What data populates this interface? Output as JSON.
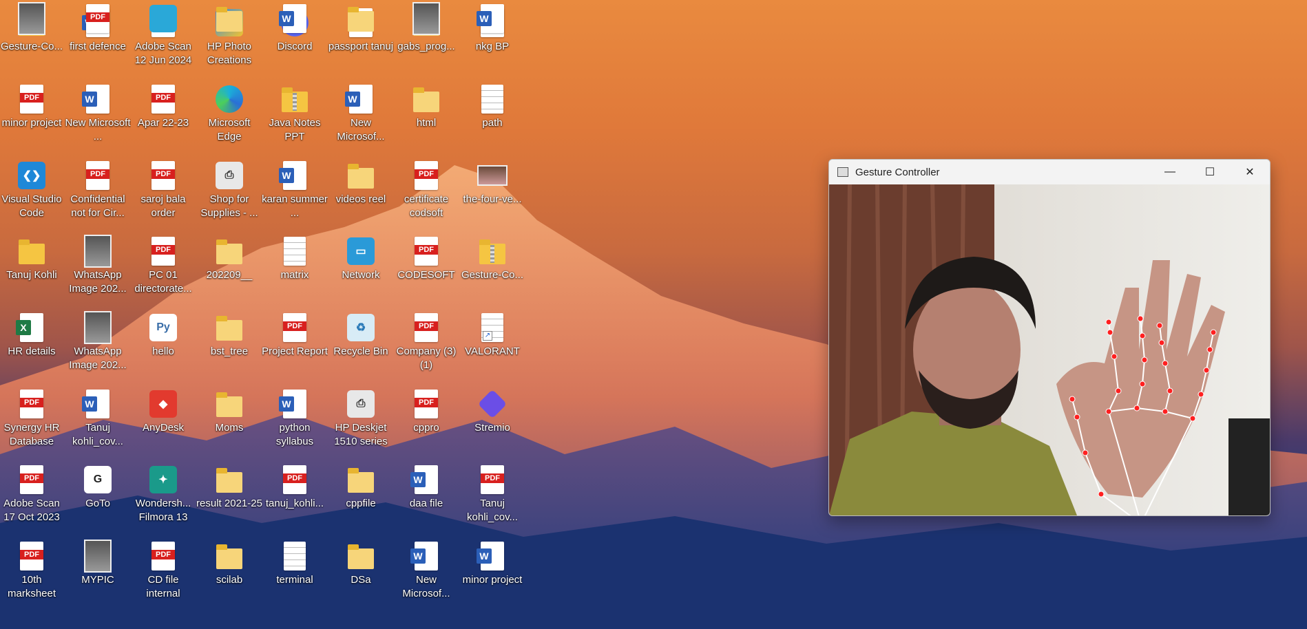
{
  "desktop": {
    "icons": [
      {
        "label": "Gesture-Co...",
        "type": "folder"
      },
      {
        "label": "first defence",
        "type": "doc"
      },
      {
        "label": "Adobe Scan 12 Jun 2024",
        "type": "pdf"
      },
      {
        "label": "HP Photo Creations",
        "type": "app-photo"
      },
      {
        "label": "Discord",
        "type": "app-discord"
      },
      {
        "label": "passport tanuj",
        "type": "pdf"
      },
      {
        "label": "gabs_prog...",
        "type": "folder-light"
      },
      {
        "label": "nkg BP",
        "type": "pdf"
      },
      {
        "label": "minor project",
        "type": "pdf"
      },
      {
        "label": "New Microsoft ...",
        "type": "doc"
      },
      {
        "label": "Apar 22-23",
        "type": "pdf"
      },
      {
        "label": "Microsoft Edge",
        "type": "app-edge"
      },
      {
        "label": "Java Notes PPT",
        "type": "folder-zip"
      },
      {
        "label": "New Microsof...",
        "type": "doc"
      },
      {
        "label": "html",
        "type": "folder-light"
      },
      {
        "label": "path",
        "type": "txt"
      },
      {
        "label": "Visual Studio Code",
        "type": "app-vscode"
      },
      {
        "label": "Confidential not for Cir...",
        "type": "pdf"
      },
      {
        "label": "saroj bala order",
        "type": "pdf"
      },
      {
        "label": "Shop for Supplies - ...",
        "type": "app-printer"
      },
      {
        "label": "karan summer ...",
        "type": "doc"
      },
      {
        "label": "videos reel",
        "type": "folder-light"
      },
      {
        "label": "certificate codsoft",
        "type": "pdf"
      },
      {
        "label": "the-four-ve...",
        "type": "image"
      },
      {
        "label": "Tanuj Kohli",
        "type": "folder"
      },
      {
        "label": "WhatsApp Image 202...",
        "type": "photo"
      },
      {
        "label": "PC 01 directorate...",
        "type": "pdf"
      },
      {
        "label": "202209__",
        "type": "folder-light"
      },
      {
        "label": "matrix",
        "type": "txt"
      },
      {
        "label": "Network",
        "type": "app-network"
      },
      {
        "label": "CODESOFT",
        "type": "pdf"
      },
      {
        "label": "Gesture-Co...",
        "type": "folder-zip"
      },
      {
        "label": "HR details",
        "type": "xls"
      },
      {
        "label": "WhatsApp Image 202...",
        "type": "photo"
      },
      {
        "label": "hello",
        "type": "app-python"
      },
      {
        "label": "bst_tree",
        "type": "folder-light"
      },
      {
        "label": "Project Report",
        "type": "pdf"
      },
      {
        "label": "Recycle Bin",
        "type": "app-recycle"
      },
      {
        "label": "Company (3) (1)",
        "type": "pdf"
      },
      {
        "label": "VALORANT",
        "type": "shortcut-file"
      },
      {
        "label": "Synergy HR Database",
        "type": "pdf"
      },
      {
        "label": "Tanuj kohli_cov...",
        "type": "doc"
      },
      {
        "label": "AnyDesk",
        "type": "app-anydesk"
      },
      {
        "label": "Moms",
        "type": "folder-light"
      },
      {
        "label": "python syllabus",
        "type": "doc"
      },
      {
        "label": "HP Deskjet 1510 series",
        "type": "app-printer"
      },
      {
        "label": "cppro",
        "type": "pdf"
      },
      {
        "label": "Stremio",
        "type": "app-stremio"
      },
      {
        "label": "Adobe Scan 17 Oct 2023",
        "type": "pdf"
      },
      {
        "label": "GoTo",
        "type": "app-goto"
      },
      {
        "label": "Wondersh... Filmora 13",
        "type": "app-filmora"
      },
      {
        "label": "result 2021-25",
        "type": "folder-light"
      },
      {
        "label": "tanuj_kohli...",
        "type": "pdf"
      },
      {
        "label": "cppfile",
        "type": "folder-light"
      },
      {
        "label": "daa file",
        "type": "doc"
      },
      {
        "label": "Tanuj kohli_cov...",
        "type": "pdf"
      },
      {
        "label": "10th marksheet",
        "type": "pdf"
      },
      {
        "label": "MYPIC",
        "type": "photo"
      },
      {
        "label": "CD file internal",
        "type": "pdf"
      },
      {
        "label": "scilab",
        "type": "folder-light"
      },
      {
        "label": "terminal",
        "type": "txt"
      },
      {
        "label": "DSa",
        "type": "folder-light"
      },
      {
        "label": "New Microsof...",
        "type": "doc"
      },
      {
        "label": "minor project",
        "type": "doc"
      },
      {
        "label": "",
        "type": "photo"
      },
      {
        "label": "",
        "type": "pdf"
      },
      {
        "label": "",
        "type": "app-blue"
      },
      {
        "label": "",
        "type": "folder-light"
      },
      {
        "label": "",
        "type": "doc"
      },
      {
        "label": "",
        "type": "folder-light"
      },
      {
        "label": "",
        "type": "photo"
      },
      {
        "label": "",
        "type": "doc"
      }
    ]
  },
  "window": {
    "title": "Gesture Controller",
    "minimize": "—",
    "maximize": "☐",
    "close": "✕"
  },
  "colors": {
    "pdf_red": "#d8201e",
    "word_blue": "#2b5fb8",
    "landmark_red": "#ff2020"
  }
}
